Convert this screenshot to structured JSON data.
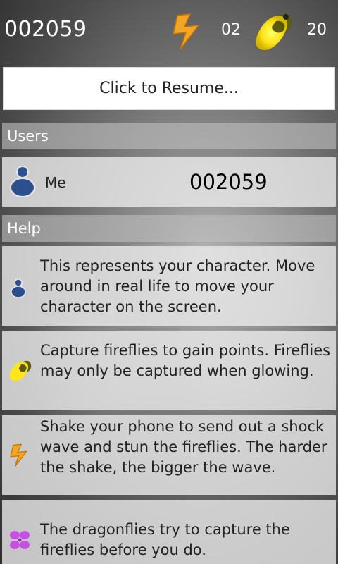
{
  "hud": {
    "score": "002059",
    "shock_count": "02",
    "firefly_count": "20",
    "lightning_icon": "lightning-icon",
    "firefly_icon": "firefly-icon"
  },
  "resume_button": {
    "label": "Click to Resume..."
  },
  "users": {
    "header": "Users",
    "items": [
      {
        "name": "Me",
        "score": "002059",
        "icon": "person-icon"
      }
    ]
  },
  "help": {
    "header": "Help",
    "items": [
      {
        "icon": "character-icon",
        "text": "This represents your character. Move around in real life to move your character on the screen."
      },
      {
        "icon": "firefly-icon",
        "text": "Capture fireflies to gain points. Fireflies may only be captured when glowing."
      },
      {
        "icon": "lightning-icon",
        "text": "Shake your phone to send out a shock wave and stun the fireflies. The harder the shake, the bigger the wave."
      },
      {
        "icon": "dragonfly-icon",
        "text": "The dragonflies try to capture the fireflies before you do."
      }
    ]
  },
  "colors": {
    "firefly_glow": "#ffe51a",
    "lightning": "#f5a524",
    "character": "#2c4f8f",
    "dragonfly": "#c84fe6"
  }
}
